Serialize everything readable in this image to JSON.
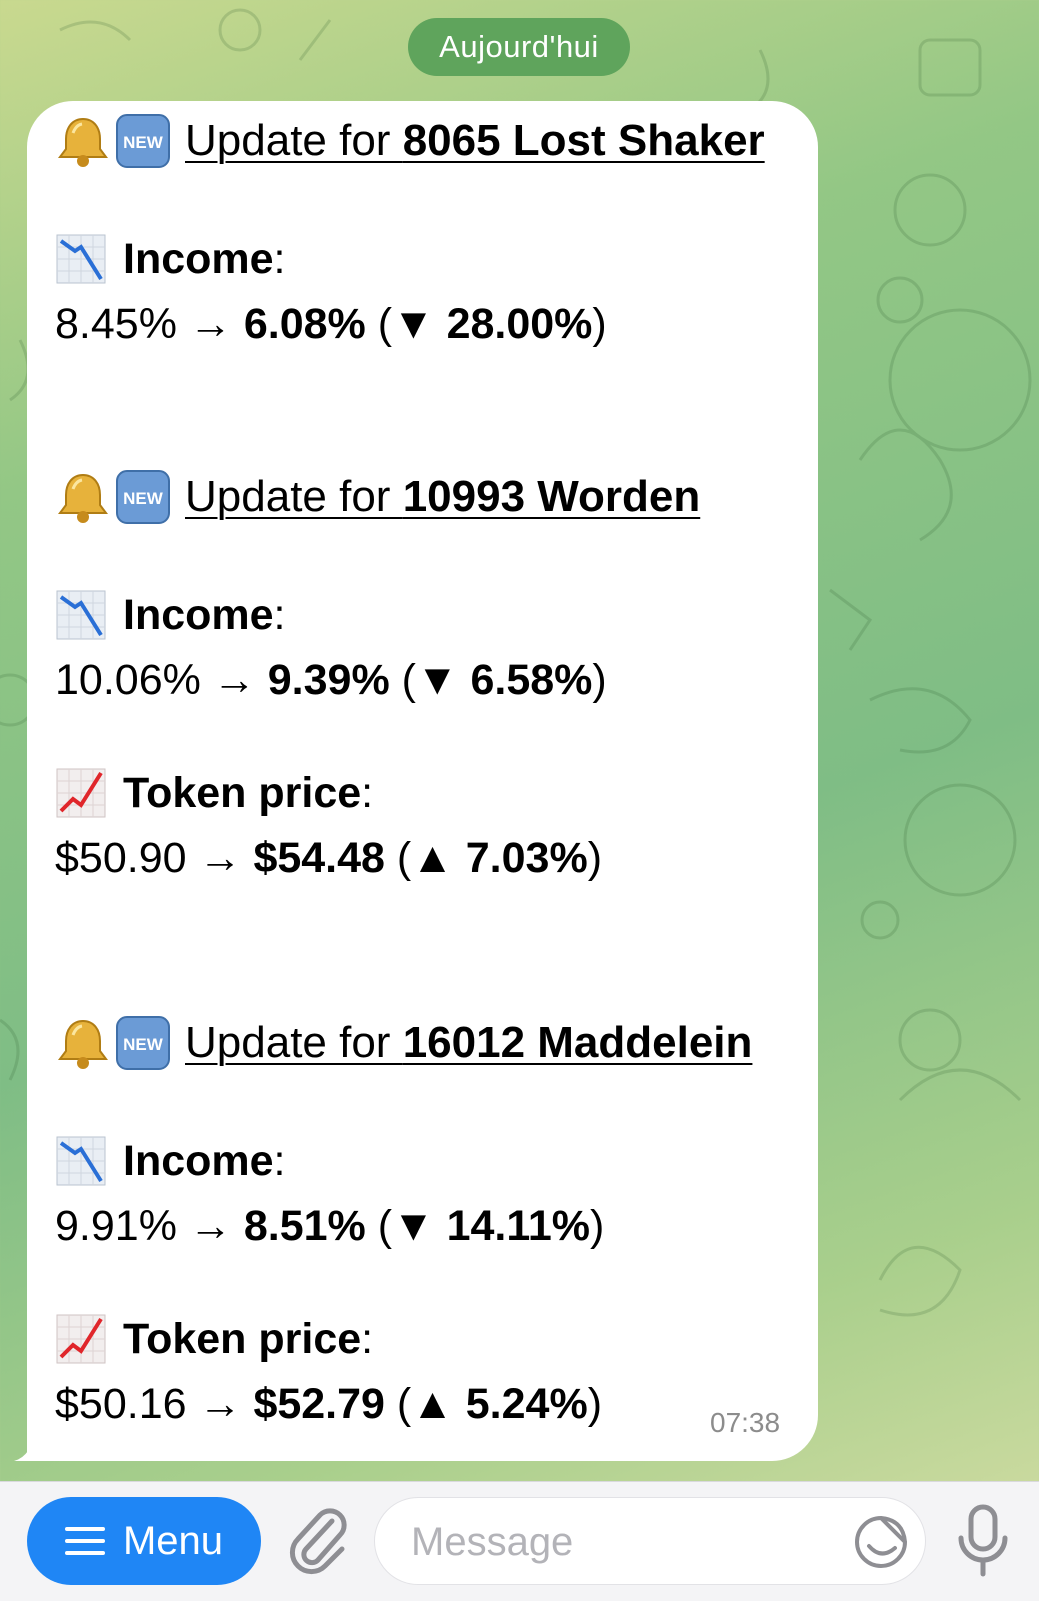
{
  "chat": {
    "date_label": "Aujourd'hui"
  },
  "message": {
    "time": "07:38",
    "updates": [
      {
        "prefix": "Update for ",
        "name": "8065 Lost Shaker",
        "metrics": [
          {
            "label": "Income",
            "colon": ":",
            "trend": "down",
            "old": "8.45%",
            "arrow": "→",
            "new": "6.08%",
            "change_symbol": "▼",
            "change": "28.00%"
          }
        ]
      },
      {
        "prefix": "Update for ",
        "name": "10993 Worden",
        "metrics": [
          {
            "label": "Income",
            "colon": ":",
            "trend": "down",
            "old": "10.06%",
            "arrow": "→",
            "new": "9.39%",
            "change_symbol": "▼",
            "change": "6.58%"
          },
          {
            "label": "Token price",
            "colon": ":",
            "trend": "up",
            "old": "$50.90",
            "arrow": "→",
            "new": "$54.48",
            "change_symbol": "▲",
            "change": "7.03%"
          }
        ]
      },
      {
        "prefix": "Update for ",
        "name": "16012 Maddelein",
        "metrics": [
          {
            "label": "Income",
            "colon": ":",
            "trend": "down",
            "old": "9.91%",
            "arrow": "→",
            "new": "8.51%",
            "change_symbol": "▼",
            "change": "14.11%"
          },
          {
            "label": "Token price",
            "colon": ":",
            "trend": "up",
            "old": "$50.16",
            "arrow": "→",
            "new": "$52.79",
            "change_symbol": "▲",
            "change": "5.24%"
          }
        ]
      }
    ]
  },
  "input_bar": {
    "menu_label": "Menu",
    "message_placeholder": "Message",
    "message_value": ""
  },
  "icons": {
    "menu": "hamburger-icon",
    "attach": "paperclip-icon",
    "sticker": "sticker-icon",
    "mic": "microphone-icon",
    "bell": "bell-emoji",
    "new": "new-button-emoji",
    "down": "chart-decreasing-emoji",
    "up": "chart-increasing-emoji"
  },
  "colors": {
    "menu_button": "#1f86f5",
    "date_pill": "#5fa45c",
    "bubble": "#ffffff",
    "timestamp": "#8c8c8c",
    "trend_down_line": "#2a6fd6",
    "trend_up_line": "#e0262b"
  }
}
